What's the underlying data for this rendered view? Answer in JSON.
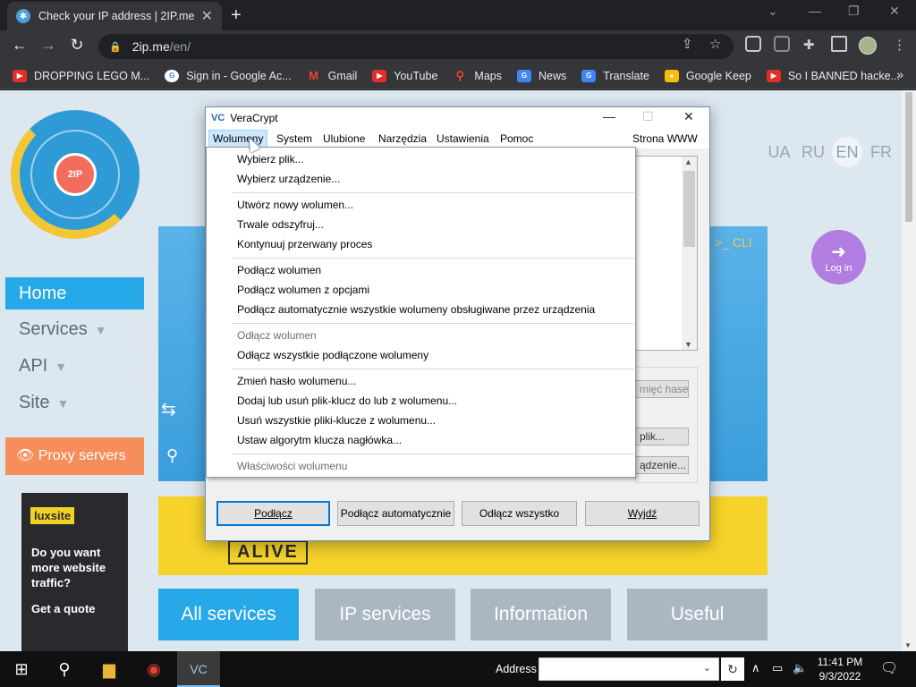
{
  "browser": {
    "tab_title": "Check your IP address | 2IP.me",
    "new_tab": "+",
    "url_host": "2ip.me",
    "url_path": "/en/",
    "bookmarks": [
      {
        "label": "DROPPING LEGO M...",
        "icon": "youtube-icon"
      },
      {
        "label": "Sign in - Google Ac...",
        "icon": "google-icon"
      },
      {
        "label": "Gmail",
        "icon": "gmail-icon"
      },
      {
        "label": "YouTube",
        "icon": "youtube-icon"
      },
      {
        "label": "Maps",
        "icon": "maps-icon"
      },
      {
        "label": "News",
        "icon": "news-icon"
      },
      {
        "label": "Translate",
        "icon": "translate-icon"
      },
      {
        "label": "Google Keep",
        "icon": "keep-icon"
      },
      {
        "label": "So I BANNED hacke...",
        "icon": "youtube-icon"
      }
    ]
  },
  "site": {
    "logo_text": "2IP",
    "languages": [
      "UA",
      "RU",
      "EN",
      "FR"
    ],
    "active_language": "EN",
    "login_label": "Log in",
    "nav": {
      "home": "Home",
      "services": "Services",
      "api": "API",
      "site": "Site"
    },
    "proxy_button": "Proxy servers",
    "hero_cli": ">_ CLI",
    "ad": {
      "brand": "luxsite",
      "text": "Do you want more website traffic?",
      "cta": "Get a quote"
    },
    "banner_text": "ALIVE",
    "service_tabs": [
      "All services",
      "IP services",
      "Information",
      "Useful"
    ],
    "colors": {
      "accent": "#27a8e8",
      "proxy": "#f58e5b",
      "login": "#b27de0",
      "banner": "#f6d32a"
    }
  },
  "veracrypt": {
    "title": "VeraCrypt",
    "menu": [
      "Wolumeny",
      "System",
      "Ulubione",
      "Narzędzia",
      "Ustawienia",
      "Pomoc"
    ],
    "menu_right": "Strona WWW",
    "side_buttons": [
      "mięć haseł",
      "plik...",
      "ądzenie..."
    ],
    "bottom_buttons": [
      "Podłącz",
      "Podłącz automatycznie",
      "Odłącz wszystko",
      "Wyjdź"
    ],
    "dropdown": [
      {
        "label": "Wybierz plik...",
        "enabled": true
      },
      {
        "label": "Wybierz urządzenie...",
        "enabled": true
      },
      {
        "label": "Utwórz nowy wolumen...",
        "enabled": true
      },
      {
        "label": "Trwale odszyfruj...",
        "enabled": true
      },
      {
        "label": "Kontynuuj przerwany proces",
        "enabled": true
      },
      {
        "label": "Podłącz wolumen",
        "enabled": true
      },
      {
        "label": "Podłącz wolumen z opcjami",
        "enabled": true
      },
      {
        "label": "Podłącz automatycznie wszystkie wolumeny obsługiwane przez urządzenia",
        "enabled": true
      },
      {
        "label": "Odłącz wolumen",
        "enabled": false
      },
      {
        "label": "Odłącz wszystkie podłączone wolumeny",
        "enabled": true
      },
      {
        "label": "Zmień hasło wolumenu...",
        "enabled": true
      },
      {
        "label": "Dodaj lub usuń plik-klucz do lub z wolumenu...",
        "enabled": true
      },
      {
        "label": "Usuń wszystkie pliki-klucze z wolumenu...",
        "enabled": true
      },
      {
        "label": "Ustaw algorytm klucza nagłówka...",
        "enabled": true
      },
      {
        "label": "Właściwości wolumenu",
        "enabled": false
      }
    ]
  },
  "taskbar": {
    "address_label": "Address",
    "time": "11:41 PM",
    "date": "9/3/2022",
    "notification_count": "1"
  }
}
